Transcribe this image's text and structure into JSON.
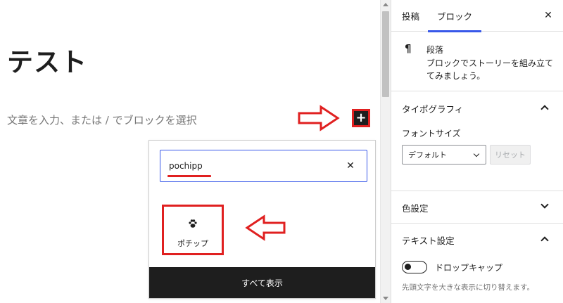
{
  "editor": {
    "post_title": "テスト",
    "paragraph_placeholder": "文章を入力、または / でブロックを選択",
    "inserter_icon": "plus-icon",
    "annotation_color": "#e02020"
  },
  "inserter": {
    "search_value": "pochipp",
    "clear_icon": "close-icon",
    "results": [
      {
        "label": "ポチップ",
        "icon": "paw-icon"
      }
    ],
    "browse_all_label": "すべて表示"
  },
  "sidebar": {
    "tabs": [
      {
        "label": "投稿",
        "active": false
      },
      {
        "label": "ブロック",
        "active": true
      }
    ],
    "close_icon": "close-icon",
    "block_card": {
      "icon": "¶",
      "title": "段落",
      "description": "ブロックでストーリーを組み立ててみましょう。"
    },
    "typography": {
      "title": "タイポグラフィ",
      "expanded": true,
      "font_size_label": "フォントサイズ",
      "font_size_value": "デフォルト",
      "reset_label": "リセット"
    },
    "color": {
      "title": "色設定",
      "expanded": false
    },
    "text_settings": {
      "title": "テキスト設定",
      "expanded": true,
      "drop_cap_label": "ドロップキャップ",
      "drop_cap_enabled": false,
      "drop_cap_help": "先頭文字を大きな表示に切り替えます。"
    }
  },
  "colors": {
    "accent": "#3858e9",
    "dark": "#1e1e1e",
    "annotation": "#e02020"
  }
}
